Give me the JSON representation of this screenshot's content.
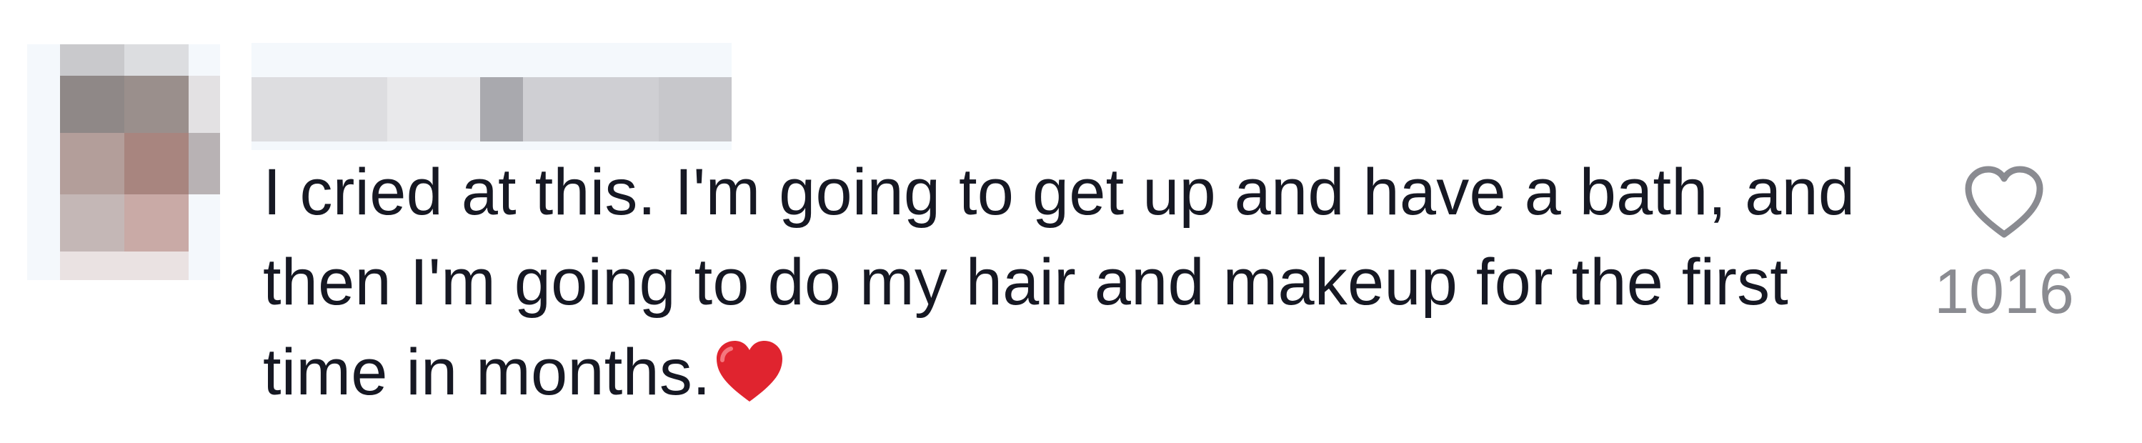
{
  "comment": {
    "text": "I cried at this. I'm going to get up and have a bath, and then I'm going to do my hair and makeup for the first time in months.",
    "emoji_icon": "red-heart-emoji",
    "like": {
      "icon": "heart-outline-icon",
      "count": "1016"
    }
  },
  "colors": {
    "text": "#161823",
    "like_count": "#8a8b91",
    "heart_outline": "#8a8b91",
    "emoji_heart": "#e0242f"
  }
}
